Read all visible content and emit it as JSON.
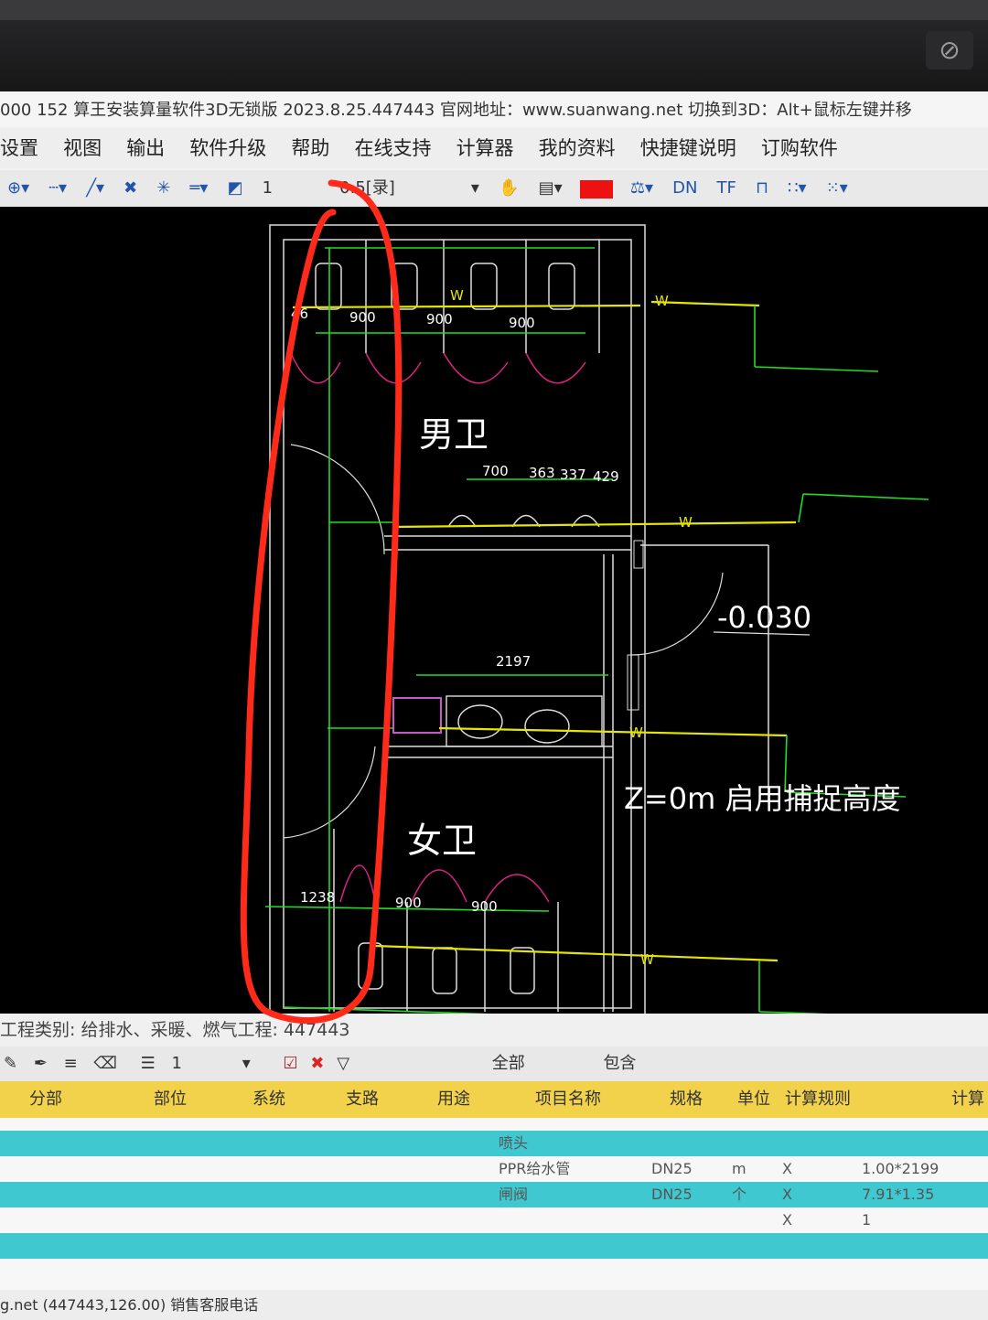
{
  "window": {
    "title": "000 152  算王安装算量软件3D无锁版 2023.8.25.447443 官网地址：www.suanwang.net  切换到3D：Alt+鼠标左键并移"
  },
  "menu": [
    "设置",
    "视图",
    "输出",
    "软件升级",
    "帮助",
    "在线支持",
    "计算器",
    "我的资料",
    "快捷键说明",
    "订购软件"
  ],
  "toolbar": {
    "scale_value": "1",
    "line_weight": "0.5[录]",
    "color_hex": "#ee1111",
    "dn_label": "DN",
    "tf_label": "TF"
  },
  "drawing": {
    "room_male": "男卫",
    "room_female": "女卫",
    "elevation": "-0.030",
    "z_note": "Z=0m  启用捕捉高度",
    "dims_top": [
      "46",
      "900",
      "900",
      "900"
    ],
    "dims_urinal": [
      "700",
      "363",
      "337",
      "429"
    ],
    "dim_sink": "2197",
    "dims_bottom": [
      "1238",
      "900",
      "900"
    ],
    "pipe_tag": "W",
    "line_colors": {
      "supply": "#e6e600",
      "dimension": "#22dd22",
      "door_arc": "#dd2288",
      "wall": "#dddddd"
    }
  },
  "bottom_panel": {
    "project_type": "工程类别: 给排水、采暖、燃气工程: 447443",
    "level_value": "1",
    "filter_label": "全部",
    "include_label": "包含",
    "columns": [
      "分部",
      "部位",
      "系统",
      "支路",
      "用途",
      "项目名称",
      "规格",
      "单位",
      "计算规则",
      "计算"
    ],
    "rows": [
      {
        "name": "喷头",
        "spec": "",
        "unit": "",
        "rule": "",
        "calc": ""
      },
      {
        "name": "PPR给水管",
        "spec": "DN25",
        "unit": "m",
        "rule": "X",
        "calc": "1.00*2199"
      },
      {
        "name": "闸阀",
        "spec": "DN25",
        "unit": "个",
        "rule": "X",
        "calc": "7.91*1.35"
      },
      {
        "name": "",
        "spec": "",
        "unit": "",
        "rule": "X",
        "calc": "1"
      }
    ]
  },
  "statusbar": {
    "text": "g.net  (447443,126.00)  销售客服电话"
  },
  "annotation": {
    "color": "#ff2a1a"
  }
}
